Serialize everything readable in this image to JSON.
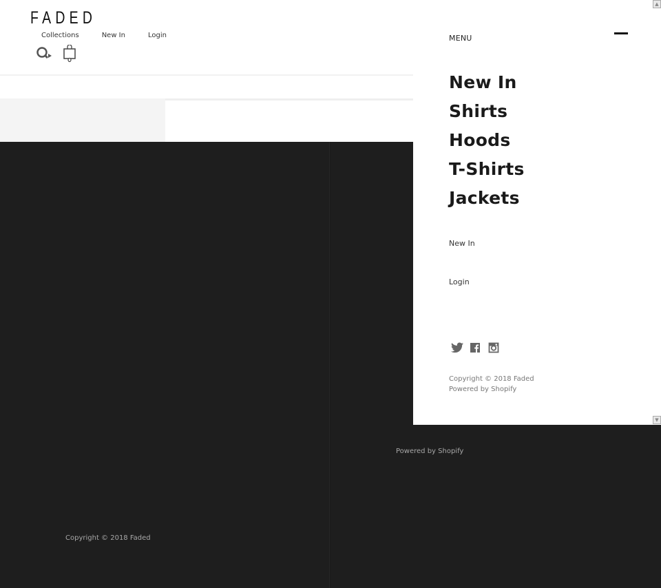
{
  "header": {
    "logo": "FADED",
    "nav": [
      {
        "label": "Collections"
      },
      {
        "label": "New In"
      },
      {
        "label": "Login"
      }
    ],
    "icons": [
      "search-icon",
      "cart-icon"
    ],
    "cart_count": "0"
  },
  "drawer": {
    "menu_label": "MENU",
    "close_icon": "close-bar-icon",
    "primary_links": [
      {
        "label": "New In"
      },
      {
        "label": "Shirts"
      },
      {
        "label": "Hoods"
      },
      {
        "label": "T-Shirts"
      },
      {
        "label": "Jackets"
      }
    ],
    "secondary_links": [
      {
        "label": "New In"
      },
      {
        "label": "Login"
      }
    ],
    "social": [
      "twitter-icon",
      "facebook-icon",
      "instagram-icon"
    ],
    "copyright": "Copyright © 2018 Faded",
    "powered_by": "Powered by Shopify"
  },
  "footer": {
    "copyright": "Copyright © 2018 Faded",
    "powered_by": "Powered by Shopify"
  },
  "scrollbar": {
    "up": "▲",
    "down": "▼"
  },
  "colors": {
    "footer_bg": "#1e1e1e",
    "drawer_bg": "#ffffff",
    "text_dark": "#1a1a1a"
  }
}
